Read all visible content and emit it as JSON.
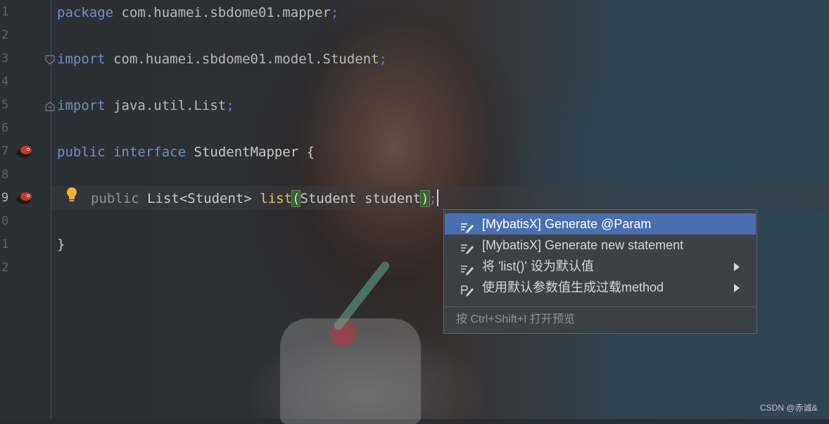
{
  "editor": {
    "line_numbers": [
      "1",
      "2",
      "3",
      "4",
      "5",
      "6",
      "7",
      "8",
      "9",
      "0",
      "1",
      "2"
    ],
    "current_line": "9",
    "lines": {
      "l1": {
        "kw": "package",
        "rest": "com.huamei.sbdome01.mapper",
        "semi": ";"
      },
      "l3": {
        "kw": "import",
        "rest": "com.huamei.sbdome01.model.Student",
        "semi": ";"
      },
      "l5": {
        "kw": "import",
        "rest": "java.util.List",
        "semi": ";"
      },
      "l7": {
        "kw1": "public",
        "kw2": "interface",
        "name": "StudentMapper",
        "brace": "{"
      },
      "l9": {
        "kw": "public",
        "type": "List<Student>",
        "method": "list",
        "open_paren": "(",
        "params": "Student student",
        "close_paren": ")",
        "semi": ";"
      },
      "l11": {
        "brace": "}"
      }
    },
    "gutter_icons": [
      "mybatis-bird-icon",
      "mybatis-bird-icon"
    ],
    "intention_icon": "lightbulb-icon"
  },
  "popup": {
    "items": [
      {
        "label": "[MybatisX] Generate @Param",
        "icon": "edit-intention-icon",
        "selected": true,
        "submenu": false
      },
      {
        "label": "[MybatisX] Generate new statement",
        "icon": "edit-intention-icon",
        "selected": false,
        "submenu": false
      },
      {
        "label": "将 'list()' 设为默认值",
        "icon": "edit-intention-icon",
        "selected": false,
        "submenu": true
      },
      {
        "label": "使用默认参数值生成过载method",
        "icon": "edit-overload-icon",
        "selected": false,
        "submenu": true
      }
    ],
    "footer": "按 Ctrl+Shift+I 打开预览"
  },
  "watermark": "CSDN @赤诚&",
  "colors": {
    "keyword": "#6f8fc9",
    "method": "#e8c46a",
    "selection": "#4b6eaf",
    "popup_bg": "#3e4145"
  }
}
